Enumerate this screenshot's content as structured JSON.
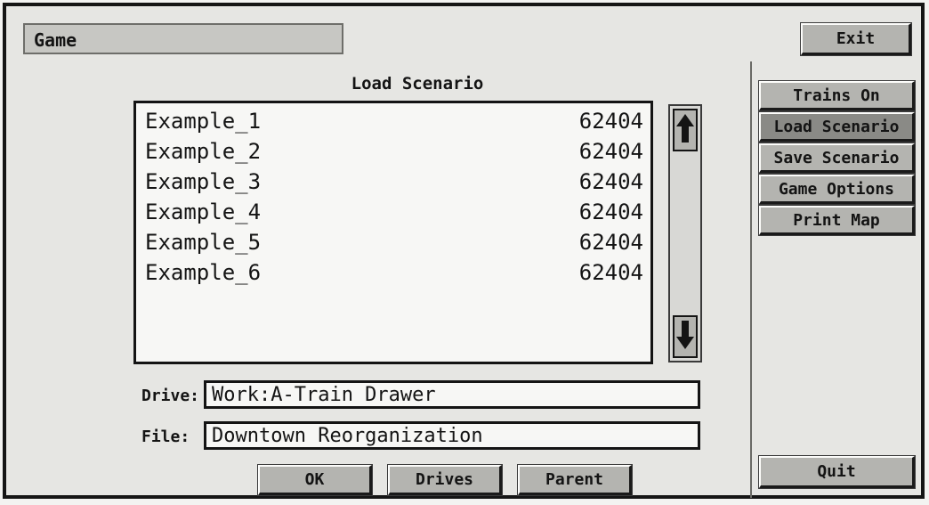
{
  "window": {
    "title": "Game",
    "exit_label": "Exit"
  },
  "menu": [
    {
      "label": "Trains On",
      "active": false
    },
    {
      "label": "Load Scenario",
      "active": true
    },
    {
      "label": "Save Scenario",
      "active": false
    },
    {
      "label": "Game Options",
      "active": false
    },
    {
      "label": "Print Map",
      "active": false
    }
  ],
  "quit_label": "Quit",
  "dialog": {
    "title": "Load Scenario",
    "files": [
      {
        "name": "Example_1",
        "size": "62404"
      },
      {
        "name": "Example_2",
        "size": "62404"
      },
      {
        "name": "Example_3",
        "size": "62404"
      },
      {
        "name": "Example_4",
        "size": "62404"
      },
      {
        "name": "Example_5",
        "size": "62404"
      },
      {
        "name": "Example_6",
        "size": "62404"
      }
    ],
    "drive_label": "Drive:",
    "drive_value": "Work:A-Train Drawer",
    "file_label": "File:",
    "file_value": "Downtown Reorganization",
    "ok_label": "OK",
    "drives_label": "Drives",
    "parent_label": "Parent"
  },
  "colors": {
    "panel": "#e6e6e3",
    "button": "#b4b4b0",
    "button_active": "#8a8a86",
    "border": "#141414"
  },
  "icons": [
    "up-arrow-icon",
    "down-arrow-icon"
  ]
}
